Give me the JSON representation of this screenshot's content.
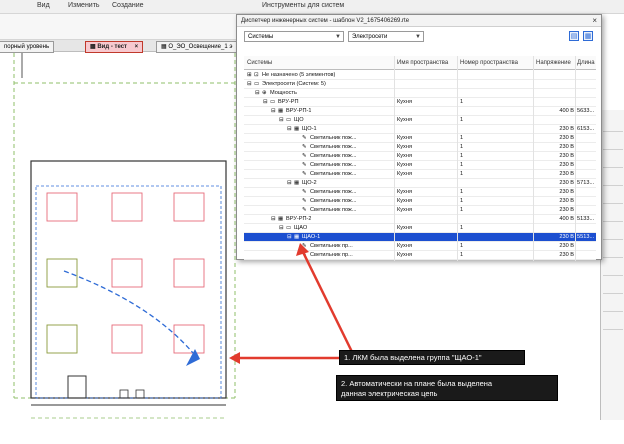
{
  "menubar": {
    "items": [
      "Вид",
      "Изменить",
      "Создание"
    ],
    "context": "Инструменты для систем"
  },
  "view_tabs": [
    {
      "label": "порный уровень",
      "active": false
    },
    {
      "label": "Вид - тест",
      "active": true
    },
    {
      "label": "О_ЭО_Освещение_1 э",
      "active": false
    }
  ],
  "dialog": {
    "title": "Диспетчер инженерных систем - шаблон V2_1675406269.rte",
    "close": "×",
    "filter_systems": "Системы",
    "filter_category": "Электросети",
    "columns": [
      "Системы",
      "Имя пространства",
      "Номер пространства",
      "Напряжение",
      "Длина"
    ],
    "rows": [
      {
        "indent": 0,
        "expander": "⊞",
        "icon": "⊡",
        "name": "Не назначено (5 элементов)",
        "space": "",
        "num": "",
        "volt": "",
        "len": "",
        "selected": false
      },
      {
        "indent": 0,
        "expander": "⊟",
        "icon": "▭",
        "name": "Электросети (Систем: 5)",
        "space": "",
        "num": "",
        "volt": "",
        "len": "",
        "selected": false
      },
      {
        "indent": 1,
        "expander": "⊟",
        "icon": "⊕",
        "name": "Мощность",
        "space": "",
        "num": "",
        "volt": "",
        "len": "",
        "selected": false
      },
      {
        "indent": 2,
        "expander": "⊟",
        "icon": "▭",
        "name": "ВРУ-РП",
        "space": "Кухня",
        "num": "1",
        "volt": "",
        "len": "",
        "selected": false
      },
      {
        "indent": 3,
        "expander": "⊟",
        "icon": "▦",
        "name": "ВРУ-РП-1",
        "space": "",
        "num": "",
        "volt": "400 В",
        "len": "5633...",
        "selected": false
      },
      {
        "indent": 4,
        "expander": "⊟",
        "icon": "▭",
        "name": "ЩО",
        "space": "Кухня",
        "num": "1",
        "volt": "",
        "len": "",
        "selected": false
      },
      {
        "indent": 5,
        "expander": "⊟",
        "icon": "▦",
        "name": "ЩО-1",
        "space": "",
        "num": "",
        "volt": "230 В",
        "len": "6153...",
        "selected": false
      },
      {
        "indent": 6,
        "expander": "",
        "icon": "✎",
        "name": "Светильник пож...",
        "space": "Кухня",
        "num": "1",
        "volt": "230 В",
        "len": "",
        "selected": false
      },
      {
        "indent": 6,
        "expander": "",
        "icon": "✎",
        "name": "Светильник пож...",
        "space": "Кухня",
        "num": "1",
        "volt": "230 В",
        "len": "",
        "selected": false
      },
      {
        "indent": 6,
        "expander": "",
        "icon": "✎",
        "name": "Светильник пож...",
        "space": "Кухня",
        "num": "1",
        "volt": "230 В",
        "len": "",
        "selected": false
      },
      {
        "indent": 6,
        "expander": "",
        "icon": "✎",
        "name": "Светильник пож...",
        "space": "Кухня",
        "num": "1",
        "volt": "230 В",
        "len": "",
        "selected": false
      },
      {
        "indent": 6,
        "expander": "",
        "icon": "✎",
        "name": "Светильник пож...",
        "space": "Кухня",
        "num": "1",
        "volt": "230 В",
        "len": "",
        "selected": false
      },
      {
        "indent": 5,
        "expander": "⊟",
        "icon": "▦",
        "name": "ЩО-2",
        "space": "",
        "num": "",
        "volt": "230 В",
        "len": "5713...",
        "selected": false
      },
      {
        "indent": 6,
        "expander": "",
        "icon": "✎",
        "name": "Светильник пож...",
        "space": "Кухня",
        "num": "1",
        "volt": "230 В",
        "len": "",
        "selected": false
      },
      {
        "indent": 6,
        "expander": "",
        "icon": "✎",
        "name": "Светильник пож...",
        "space": "Кухня",
        "num": "1",
        "volt": "230 В",
        "len": "",
        "selected": false
      },
      {
        "indent": 6,
        "expander": "",
        "icon": "✎",
        "name": "Светильник пож...",
        "space": "Кухня",
        "num": "1",
        "volt": "230 В",
        "len": "",
        "selected": false
      },
      {
        "indent": 3,
        "expander": "⊟",
        "icon": "▦",
        "name": "ВРУ-РП-2",
        "space": "",
        "num": "",
        "volt": "400 В",
        "len": "5133...",
        "selected": false
      },
      {
        "indent": 4,
        "expander": "⊟",
        "icon": "▭",
        "name": "ЩАО",
        "space": "Кухня",
        "num": "1",
        "volt": "",
        "len": "",
        "selected": false
      },
      {
        "indent": 5,
        "expander": "⊟",
        "icon": "▦",
        "name": "ЩАО-1",
        "space": "",
        "num": "",
        "volt": "230 В",
        "len": "5513...",
        "selected": true
      },
      {
        "indent": 6,
        "expander": "",
        "icon": "✎",
        "name": "Светильник пр...",
        "space": "Кухня",
        "num": "1",
        "volt": "230 В",
        "len": "",
        "selected": false
      },
      {
        "indent": 6,
        "expander": "",
        "icon": "✎",
        "name": "Светильник пр...",
        "space": "Кухня",
        "num": "1",
        "volt": "230 В",
        "len": "",
        "selected": false
      }
    ]
  },
  "callouts": {
    "first": "1. ЛКМ была выделена группа \"ЩАО-1\"",
    "second_line1": "2. Автоматически на плане была выделена",
    "second_line2": "данная электрическая цепь"
  },
  "colors": {
    "selection": "#1c4fd0",
    "fixture_red": "#e66b7a",
    "fixture_green": "#8a9a3a",
    "circuit_blue": "#2e6bd6",
    "arrow_red": "#e23b2e"
  }
}
